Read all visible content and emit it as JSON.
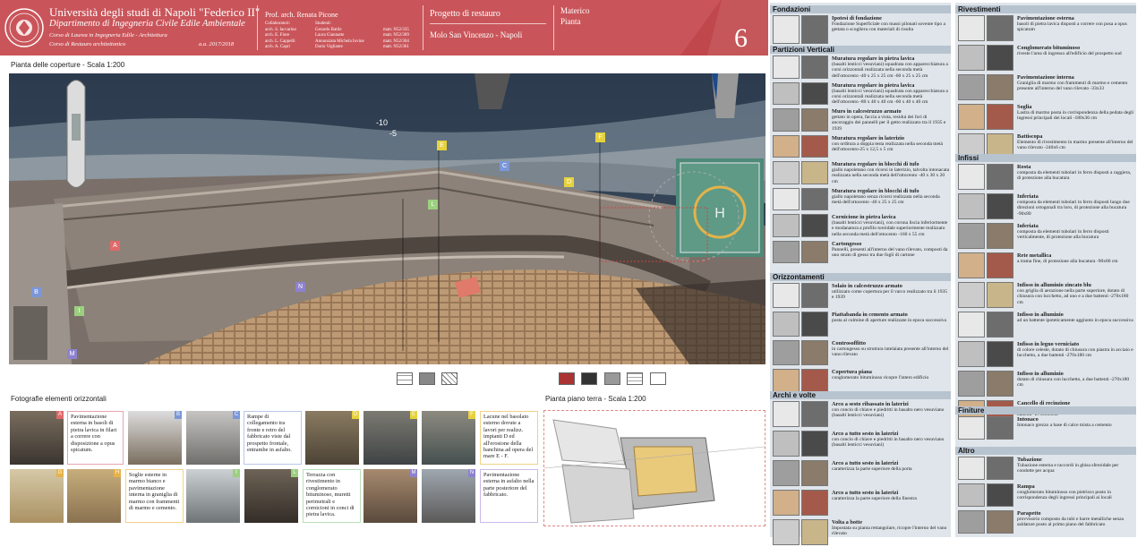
{
  "header": {
    "university": "Università degli studi di Napoli \"Federico II\"",
    "department": "Dipartimento di Ingegneria Civile Edile Ambientale",
    "course1": "Corso di Laurea in Ingegneria Edile - Architettura",
    "course2": "Corso di Restauro architettonico",
    "year": "a.a.  2017/2018",
    "professor": "Prof. arch. Renata Picone",
    "collab_label": "Collaboratori:",
    "collaborators": [
      "arch. S. Iaccarino",
      "arch. E. Fiore",
      "arch. L. Cappelli",
      "arch. A. Capri"
    ],
    "students_label": "Studenti:",
    "students": [
      "Gerardo Batile",
      "Laura Giannatte",
      "Annunziata Michela Iovine",
      "Dario Vigliante"
    ],
    "matr": [
      "matr.  N52/335",
      "matr.  N52/309",
      "matr.  N52/304",
      "matr.  N52/361"
    ],
    "project": "Progetto di restauro",
    "location": "Molo San Vincenzo - Napoli",
    "materico": "Materico",
    "pianta": "Pianta",
    "number": "6"
  },
  "plan_title": "Pianta delle coperture - Scala 1:200",
  "ground_title": "Pianta piano terra - Scala 1:200",
  "photos_title": "Fotografie elementi orizzontali",
  "map_labels": {
    "depth10": "-10",
    "depth5": "-5",
    "heli": "H"
  },
  "area_labels": [
    "A",
    "B",
    "C",
    "D",
    "E",
    "F",
    "I",
    "L",
    "M",
    "N"
  ],
  "photo_tags": [
    "A",
    "B",
    "C",
    "D",
    "E",
    "F",
    "G",
    "H",
    "I",
    "L",
    "M",
    "N"
  ],
  "photo_texts": {
    "A": "Pavimentazione esterna in basoli di pietra lavica in filari a correre con disposizione a opus spicatum.",
    "C": "Rampe di collegamento tra fronte e retro del fabbricato viste dal prospetto frontale, entrambe in asfalto.",
    "F": "Lacune nel basolato esterno dovute a lavori per realizz. impianti D ed all'erosione della banchina ad opera del mare E - F.",
    "H": "Soglie esterne in marmo bianco e pavimentazione interna in graniglia di marmo con frammenti di marmo e cemento.",
    "L": "Terrazza con rivestimento in conglomerato bituminoso, muretti perimetrali e cornicioni in conci di pietra lavica.",
    "N": "Pavimentazione esterna in asfalto nella parte posteriore del fabbricato."
  },
  "legend": {
    "col1": {
      "fondazioni": {
        "title": "Fondazioni",
        "items": [
          {
            "t": "Ipotesi di fondazione",
            "d": "Fondazione Superficiale con massi pilonati sovente tipo a gettata o scogliera con materiali di risulta"
          }
        ]
      },
      "partizioni": {
        "title": "Partizioni Verticali",
        "items": [
          {
            "t": "Muratura regolare in pietra lavica",
            "d": "(basalti lenticci vesuviani) squadrata con apparecchiatura a corsi orizzontali realizzata nella seconda metà dell'ottocento -40 x 25 x 25 cm -60 x 25 x 25 cm"
          },
          {
            "t": "Muratura regolare in pietra lavica",
            "d": "(basalti lenticci vesuviani) squadrata con apparecchiatura a corsi orizzontali realizzata nella seconda metà dell'ottocento -80 x 40 x 40 cm -60 x 40 x 40 cm"
          },
          {
            "t": "Muro in calcestruzzo armato",
            "d": "gettato in opera, faccia a vista, residui dei fori di ancoraggio dei pannelli per il getto realizzato tra il 1935 e 1939"
          },
          {
            "t": "Muratura regolare in laterizio",
            "d": "con orditura a doppia testa realizzata nella seconda metà dell'ottocento-25 x 12,5 x 5 cm"
          },
          {
            "t": "Muratura regolare in blocchi di tufo",
            "d": "giallo napoletano con ricorsi in laterizio, talvolta intonacata realizzata nella seconda metà dell'ottocento -40 x 30 x 20 cm"
          },
          {
            "t": "Muratura regolare in blocchi di tufo",
            "d": "giallo napoletano senza ricorsi realizzata nella seconda metà dell'ottocento -40 x 25 x 25 cm"
          },
          {
            "t": "Cornicione in pietra lavica",
            "d": "(basalti lenticci vesuviani), con corona liscia inferiormente e modanatura a profilo toroidale superiormente realizzato nella seconda metà dell'ottocento -160 x 55 cm"
          },
          {
            "t": "Cartongesso",
            "d": "Pannelli, presenti all'interno del vano rilevato, composti da uno strato di gesso tra due fogli di cartone"
          }
        ]
      },
      "orizzontamenti": {
        "title": "Orizzontamenti",
        "items": [
          {
            "t": "Solaio in calcestruzzo armato",
            "d": "utilizzato come copertura per il varco realizzato tra il 1935 e 1939"
          },
          {
            "t": "Piattabanda in cemento armato",
            "d": "posta al culmine di aperture realizzate in epoca successiva"
          },
          {
            "t": "Controsoffitto",
            "d": "in cartongesso su struttura intelaiata presente all'interno del vano rilevato"
          },
          {
            "t": "Copertura piana",
            "d": "conglomerato bituminoso ricopre l'intero edificio"
          }
        ]
      },
      "archi": {
        "title": "Archi e volte",
        "items": [
          {
            "t": "Arco a sesto ribassato in laterizi",
            "d": "con concio di chiave e piedritti in basalto nero vesuviano (basalti lenticci vesuviani)"
          },
          {
            "t": "Arco a tutto sesto in laterizi",
            "d": "con concio di chiave e piedritti in basalto nero vesuviano (basalti lenticci vesuviani)"
          },
          {
            "t": "Arco a tutto sesto in laterizi",
            "d": "caratterizza la parte superiore della porta"
          },
          {
            "t": "Arco a tutto sesto in laterizi",
            "d": "caratterizza la parte superiore della finestra"
          },
          {
            "t": "Volta a botte",
            "d": "Impostata su pianta rettangolare, ricopre l'interno del vano rilevato"
          }
        ]
      }
    },
    "col2": {
      "rivestimenti": {
        "title": "Rivestimenti",
        "items": [
          {
            "t": "Pavimentazione esterna",
            "d": "basoli di pietra lavica disposti a correre con posa a opus spicatum"
          },
          {
            "t": "Conglomerato bituminoso",
            "d": "riveste l'area di ingresso all'edificio del prospetto sud"
          },
          {
            "t": "Pavimentazione interna",
            "d": "Graniglia di marmo con frammenti di marmo e cemento presente all'interno del vano rilevato -33x33"
          },
          {
            "t": "Soglia",
            "d": "Lastra di marmo posta in corrispondenza della pedata degli ingressi principali dei locali -180x36 cm"
          },
          {
            "t": "Battiscopa",
            "d": "Elemento di rivestimento in marmo presente all'interno del vano rilevato -240x6 cm"
          }
        ]
      },
      "infissi": {
        "title": "Infissi",
        "items": [
          {
            "t": "Rosta",
            "d": "composta da elementi tubolari in ferro disposti a raggiera, di protezione alla bucatura"
          },
          {
            "t": "Inferiata",
            "d": "composta da elementi tubolari in ferro disposti lungo due direzioni ortogonali tra loro, di protezione alla bucatura -90x80"
          },
          {
            "t": "Inferiata",
            "d": "composta da elementi tubolari in ferro disposti verticalmente, di protezione alla bucatura"
          },
          {
            "t": "Rete metallica",
            "d": "a trama fine, di protezione alla bucatura -90x80 cm"
          },
          {
            "t": "Infisso in alluminio zincato blu",
            "d": "con griglia di aerazione nella parte superiore, dotato di chiusura con lucchetto, ad uno e a due battenti -270x180 cm"
          },
          {
            "t": "Infisso in alluminio",
            "d": "ad un battente ipoteticamente aggiunto in epoca successiva"
          },
          {
            "t": "Infisso  in legno verniciato",
            "d": "di colore celeste, dotato di chiusura con piastra in acciaio e lucchetto, a due battenti -270x180 cm"
          },
          {
            "t": "Infisso in alluminio",
            "d": "dotato di chiusura con lucchetto, a due battenti -270x180 cm"
          },
          {
            "t": "Cancello di recinzione",
            "d": "in alluminio zincato e verniciato, di colore grigio, a due battenti -270x800cm"
          }
        ]
      },
      "finiture": {
        "title": "Finiture",
        "items": [
          {
            "t": "Intonaco",
            "d": "Intonaco grezzo  a base di calce mista a cemento"
          }
        ]
      },
      "altro": {
        "title": "Altro",
        "items": [
          {
            "t": "Tubazione",
            "d": "Tubazione esterna e raccordi in ghisa sferoidale per condotte per acqua"
          },
          {
            "t": "Rampa",
            "d": "conglomerato bituminoso con pietrisco posto in corrispondenza degli ingressi principali ai locali"
          },
          {
            "t": "Parapetto",
            "d": "provvisorio composto da tubi e barre metalliche senza saldature posto al primo piano del fabbricato"
          }
        ]
      }
    }
  },
  "colors": {
    "header": "#c9555a",
    "legend_bg": "#dfe5ea",
    "legend_cat": "#b7c3cf",
    "sea": "#2e3f55"
  }
}
